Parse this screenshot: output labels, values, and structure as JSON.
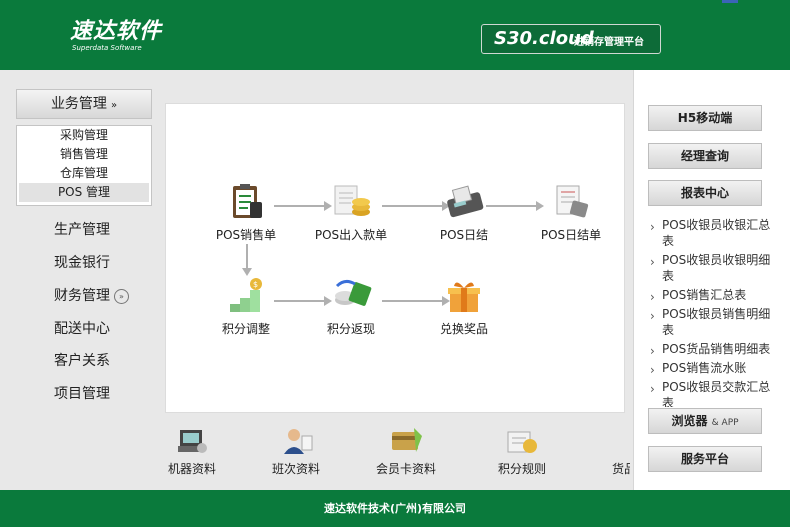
{
  "header": {
    "logo_cn": "速达软件",
    "logo_en": "Superdata Software",
    "brand_model": "S30.cloud",
    "brand_subtitle": "进销存管理平台"
  },
  "sidebar": {
    "category": "业务管理",
    "submenu": [
      "采购管理",
      "销售管理",
      "仓库管理",
      "POS 管理"
    ],
    "active_submenu": "POS 管理",
    "items": [
      "生产管理",
      "现金银行",
      "财务管理",
      "配送中心",
      "客户关系",
      "项目管理"
    ]
  },
  "flow": {
    "nodes": [
      "POS销售单",
      "POS出入款单",
      "POS日结",
      "POS日结单",
      "积分调整",
      "积分返现",
      "兑换奖品"
    ]
  },
  "bottom": {
    "items": [
      "机器资料",
      "班次资料",
      "会员卡资料",
      "积分规则",
      "货品"
    ]
  },
  "right": {
    "buttons": [
      "H5移动端",
      "经理查询",
      "报表中心"
    ],
    "reports": [
      "POS收银员收银汇总表",
      "POS收银员收银明细表",
      "POS销售汇总表",
      "POS收银员销售明细表",
      "POS货品销售明细表",
      "POS销售流水账",
      "POS收银员交款汇总表"
    ],
    "browser_app": "浏览器",
    "browser_app_amp": "& APP",
    "service": "服务平台"
  },
  "footer": {
    "company": "速达软件技术(广州)有限公司"
  },
  "colors": {
    "brand_green": "#0a7a3c",
    "panel_gray": "#e8e8e8"
  }
}
